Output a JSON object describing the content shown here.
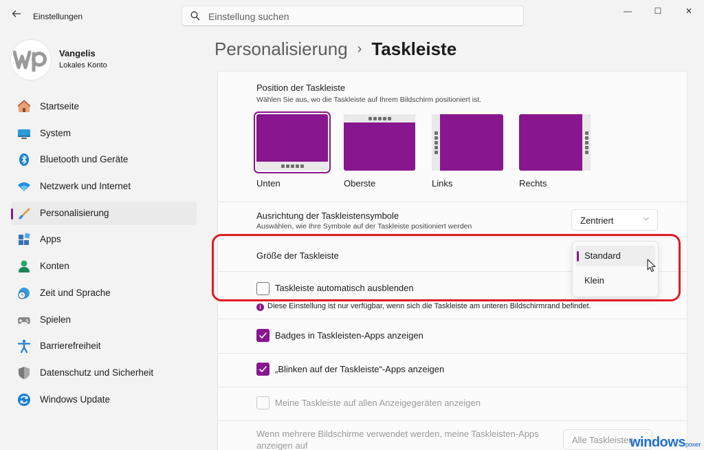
{
  "window": {
    "title": "Einstellungen",
    "controls": {
      "minimize": "—",
      "maximize": "☐",
      "close": "✕"
    }
  },
  "search": {
    "placeholder": "Einstellung suchen"
  },
  "profile": {
    "name": "Vangelis",
    "account_type": "Lokales Konto"
  },
  "sidebar": {
    "items": [
      {
        "label": "Startseite",
        "icon": "home-icon",
        "active": false
      },
      {
        "label": "System",
        "icon": "system-icon",
        "active": false
      },
      {
        "label": "Bluetooth und Geräte",
        "icon": "bluetooth-icon",
        "active": false
      },
      {
        "label": "Netzwerk und Internet",
        "icon": "wifi-icon",
        "active": false
      },
      {
        "label": "Personalisierung",
        "icon": "brush-icon",
        "active": true
      },
      {
        "label": "Apps",
        "icon": "apps-icon",
        "active": false
      },
      {
        "label": "Konten",
        "icon": "account-icon",
        "active": false
      },
      {
        "label": "Zeit und Sprache",
        "icon": "clock-globe-icon",
        "active": false
      },
      {
        "label": "Spielen",
        "icon": "gamepad-icon",
        "active": false
      },
      {
        "label": "Barrierefreiheit",
        "icon": "accessibility-icon",
        "active": false
      },
      {
        "label": "Datenschutz und Sicherheit",
        "icon": "shield-icon",
        "active": false
      },
      {
        "label": "Windows Update",
        "icon": "update-icon",
        "active": false
      }
    ]
  },
  "header": {
    "breadcrumb": "Personalisierung",
    "separator": "›",
    "title": "Taskleiste"
  },
  "position": {
    "title": "Position der Taskleiste",
    "description": "Wählen Sie aus, wo die Taskleiste auf Ihrem Bildschirm positioniert ist.",
    "options": [
      {
        "label": "Unten",
        "selected": true
      },
      {
        "label": "Oberste",
        "selected": false
      },
      {
        "label": "Links",
        "selected": false
      },
      {
        "label": "Rechts",
        "selected": false
      }
    ]
  },
  "alignment": {
    "title": "Ausrichtung der Taskleistensymbole",
    "description": "Auswählen, wie Ihre Symbole auf der Taskleiste positioniert werden",
    "value": "Zentriert"
  },
  "size": {
    "title": "Größe der Taskleiste",
    "options": [
      {
        "label": "Standard",
        "selected": true
      },
      {
        "label": "Klein",
        "selected": false
      }
    ]
  },
  "autohide": {
    "label": "Taskleiste automatisch ausblenden",
    "checked": false,
    "info": "Diese Einstellung ist nur verfügbar, wenn sich die Taskleiste am unteren Bildschirmrand befindet."
  },
  "badges": {
    "label": "Badges in Taskleisten-Apps anzeigen",
    "checked": true
  },
  "flashing": {
    "label": "„Blinken auf der Taskleiste“-Apps anzeigen",
    "checked": true
  },
  "all_displays": {
    "label": "Meine Taskleiste auf allen Anzeigegeräten anzeigen",
    "checked": false,
    "disabled": true
  },
  "multi_display": {
    "label": "Wenn mehrere Bildschirme verwendet werden, meine Taskleisten-Apps anzeigen auf",
    "button": "Alle Taskleisten"
  },
  "watermark": {
    "main": "windows",
    "sub": "power"
  },
  "colors": {
    "accent": "#88168e",
    "highlight": "#e01a22"
  }
}
